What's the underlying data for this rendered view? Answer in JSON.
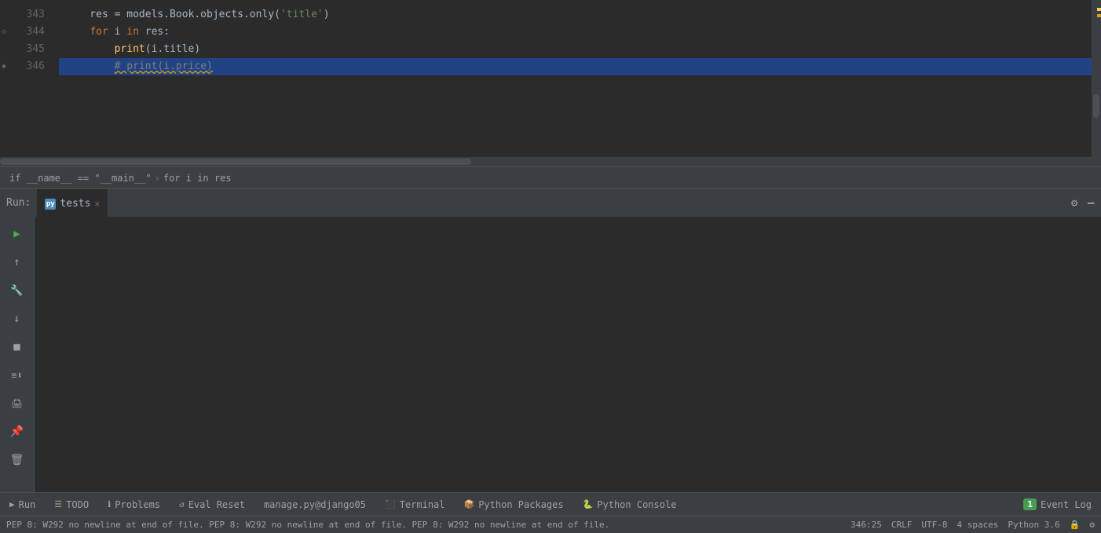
{
  "editor": {
    "lines": [
      {
        "num": "343",
        "content_parts": [
          {
            "text": "    res = models.Book.objects.only(",
            "cls": "var"
          },
          {
            "text": "'title'",
            "cls": "str"
          },
          {
            "text": ")",
            "cls": "var"
          }
        ],
        "selected": false
      },
      {
        "num": "344",
        "content_parts": [
          {
            "text": "    ",
            "cls": "var"
          },
          {
            "text": "for",
            "cls": "kw"
          },
          {
            "text": " i ",
            "cls": "var"
          },
          {
            "text": "in",
            "cls": "kw"
          },
          {
            "text": " res:",
            "cls": "var"
          }
        ],
        "fold": "down",
        "selected": false
      },
      {
        "num": "345",
        "content_parts": [
          {
            "text": "        ",
            "cls": "var"
          },
          {
            "text": "print",
            "cls": "fn"
          },
          {
            "text": "(i.title)",
            "cls": "var"
          }
        ],
        "selected": false
      },
      {
        "num": "346",
        "content_parts": [
          {
            "text": "        ",
            "cls": "var"
          },
          {
            "text": "# print(i.price)",
            "cls": "comment squiggle"
          }
        ],
        "fold": "up",
        "selected": true
      }
    ],
    "breadcrumb": {
      "item1": "if __name__ == \"__main__\"",
      "arrow": "›",
      "item2": "for i in res"
    }
  },
  "run_panel": {
    "label": "Run:",
    "tab_name": "tests",
    "tab_icon": "py"
  },
  "run_sidebar_buttons": [
    {
      "name": "play",
      "icon": "▶",
      "active": true
    },
    {
      "name": "up",
      "icon": "↑",
      "active": false
    },
    {
      "name": "wrench",
      "icon": "🔧",
      "active": false
    },
    {
      "name": "down",
      "icon": "↓",
      "active": false
    },
    {
      "name": "stop",
      "icon": "■",
      "active": false
    },
    {
      "name": "layers",
      "icon": "≡",
      "active": false
    },
    {
      "name": "down2",
      "icon": "⬇",
      "active": false
    },
    {
      "name": "print",
      "icon": "🖨",
      "active": false
    },
    {
      "name": "pin",
      "icon": "📌",
      "active": false
    },
    {
      "name": "trash",
      "icon": "🗑",
      "active": false
    }
  ],
  "bottom_toolbar": {
    "tabs": [
      {
        "name": "run-tab",
        "icon": "▶",
        "label": "Run"
      },
      {
        "name": "todo-tab",
        "icon": "☰",
        "label": "TODO"
      },
      {
        "name": "problems-tab",
        "icon": "ℹ",
        "label": "Problems"
      },
      {
        "name": "eval-reset-tab",
        "icon": "↺",
        "label": "Eval Reset"
      },
      {
        "name": "manage-tab",
        "icon": "",
        "label": "manage.py@django05"
      },
      {
        "name": "terminal-tab",
        "icon": "⬛",
        "label": "Terminal"
      },
      {
        "name": "python-packages-tab",
        "icon": "📦",
        "label": "Python Packages"
      },
      {
        "name": "python-console-tab",
        "icon": "🐍",
        "label": "Python Console"
      }
    ],
    "event_log": {
      "badge": "1",
      "label": "Event Log"
    }
  },
  "status_bar": {
    "left": "PEP 8: W292 no newline at end of file.  PEP 8: W292 no newline at end of file.  PEP 8: W292 no newline at end of file.",
    "position": "346:25",
    "line_ending": "CRLF",
    "encoding": "UTF-8",
    "indent": "4 spaces",
    "python_version": "Python 3.6",
    "lock_icon": "🔒",
    "settings_icon": "⚙"
  },
  "settings_icon_label": "⚙",
  "minimize_icon_label": "−"
}
